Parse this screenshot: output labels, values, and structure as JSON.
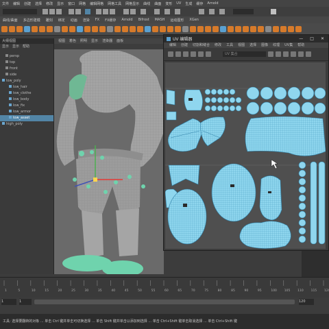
{
  "menubar": {
    "items": [
      "文件",
      "编辑",
      "创建",
      "选择",
      "修改",
      "显示",
      "窗口",
      "网格",
      "编辑网格",
      "网格工具",
      "网格显示",
      "曲线",
      "曲面",
      "变形",
      "UV",
      "生成",
      "缓存",
      "Arnold"
    ]
  },
  "shelf": {
    "tabs": [
      "曲线/曲面",
      "多边形建模",
      "雕刻",
      "绑定",
      "动画",
      "渲染",
      "FX",
      "FX缓存",
      "Arnold",
      "Bifrost",
      "MASH",
      "运动图形",
      "XGen"
    ]
  },
  "outliner": {
    "title": "大纲视图",
    "menu": [
      "显示",
      "显示",
      "帮助"
    ],
    "items": [
      {
        "label": "persp",
        "indent": 1,
        "selected": false
      },
      {
        "label": "top",
        "indent": 1,
        "selected": false
      },
      {
        "label": "front",
        "indent": 1,
        "selected": false
      },
      {
        "label": "side",
        "indent": 1,
        "selected": false
      },
      {
        "label": "low_poly",
        "indent": 0,
        "selected": false
      },
      {
        "label": "low_hair",
        "indent": 2,
        "selected": false
      },
      {
        "label": "low_clothe",
        "indent": 2,
        "selected": false
      },
      {
        "label": "low_body",
        "indent": 2,
        "selected": false
      },
      {
        "label": "low_fix",
        "indent": 2,
        "selected": false
      },
      {
        "label": "low_armor",
        "indent": 2,
        "selected": false
      },
      {
        "label": "low_asset",
        "indent": 2,
        "selected": true
      },
      {
        "label": "high_poly",
        "indent": 0,
        "selected": false
      }
    ]
  },
  "viewport": {
    "menu": [
      "视图",
      "着色",
      "照明",
      "显示",
      "渲染器",
      "面板"
    ]
  },
  "uv_editor": {
    "title": "UV 编辑器",
    "menu": [
      "编辑",
      "创建",
      "切割和缝合",
      "修改",
      "工具",
      "视图",
      "选择",
      "图像",
      "纹理",
      "UV集",
      "帮助"
    ],
    "search_placeholder": "UV 集合",
    "window_controls": [
      "—",
      "□",
      "✕"
    ]
  },
  "timeline": {
    "ticks": [
      "1",
      "5",
      "10",
      "15",
      "20",
      "25",
      "30",
      "35",
      "40",
      "45",
      "50",
      "55",
      "60",
      "65",
      "70",
      "75",
      "80",
      "85",
      "90",
      "95",
      "100",
      "105",
      "110",
      "115",
      "120"
    ]
  },
  "range": {
    "start": "1",
    "start2": "1",
    "end": "120"
  },
  "command_line": "工具: 选择要翻转的对象 ... 单击 Ctrl 键并单击可切换选择 ... 单击 Shift 键并单击以添加到选择 ... 单击 Ctrl+Shift 键单击取消选择 ... 单击 Ctrl+Shift 键",
  "colors": {
    "uv_shell": "#8fd6ee",
    "uv_edge": "#2e7fa6",
    "accent": "#5285a6",
    "character": "#9a9a9a",
    "shoe": "#6fd3ad"
  }
}
